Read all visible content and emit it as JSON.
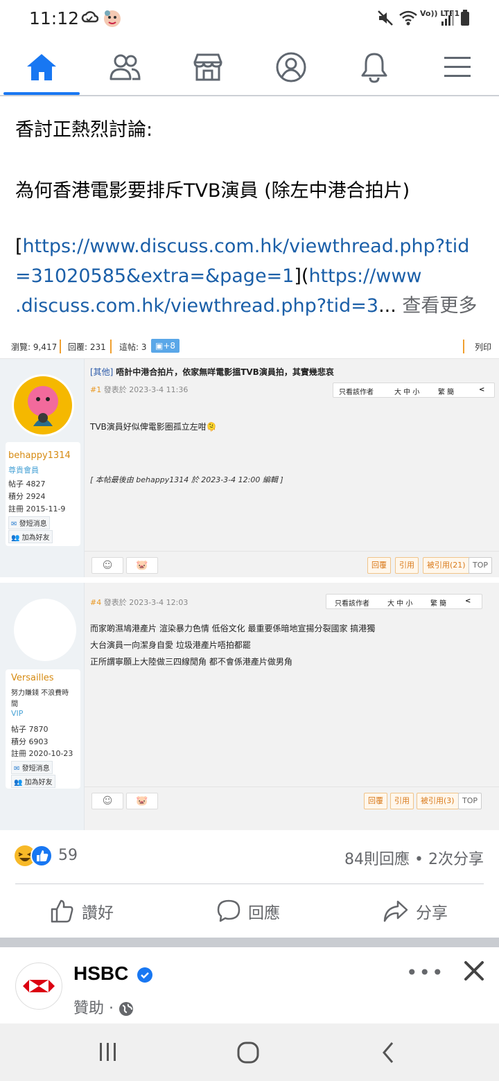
{
  "status_bar": {
    "time": "11:12",
    "network": "Vo)) LTE1"
  },
  "nav": {
    "items": [
      {
        "icon": "home-icon",
        "active": true
      },
      {
        "icon": "friends-icon",
        "active": false
      },
      {
        "icon": "marketplace-icon",
        "active": false
      },
      {
        "icon": "profile-icon",
        "active": false
      },
      {
        "icon": "bell-icon",
        "active": false
      },
      {
        "icon": "menu-icon",
        "active": false
      }
    ],
    "accent": "#1877f2"
  },
  "post": {
    "line1": "香討正熱烈討論:",
    "line2": "為何香港電影要排斥TVB演員 (除左中港合拍片)",
    "link_line1": "https://www.discuss.com.hk/viewthread.php?tid",
    "link_line2_a": "=31020585&extra=&page=1",
    "link_line2_b": "https://www",
    "link_line3": ".discuss.com.hk/viewthread.php?tid=3",
    "ellipsis": "...",
    "see_more": "查看更多"
  },
  "forum": {
    "toolbar": {
      "views": "瀏覽: 9,417",
      "replies": "回覆: 231",
      "posts": "這帖: 3",
      "badge": "+8",
      "print": "列印"
    },
    "post1": {
      "title_cat": "[其他]",
      "title": "唔計中港合拍片，依家無咩電影搵TVB演員拍，其實幾悲哀",
      "floor": "#1",
      "meta": "發表於 2023-3-4 11:36",
      "buttons": [
        "只看該作者",
        "大 中 小",
        "繁 簡",
        "<"
      ],
      "body": "TVB演員好似俾電影圈孤立左咁🫠",
      "edit_note": "[  本帖最後由  behappy1314  於  2023-3-4  12:00  編輯  ]",
      "user": {
        "name": "behappy1314",
        "rank": "尊貴會員",
        "posts": "帖子  4827",
        "points": "積分  2924",
        "reg": "註冊  2015-11-9",
        "pm": "發短消息",
        "friend": "加為好友"
      },
      "actions": [
        "回覆",
        "引用",
        "被引用(21)",
        "TOP"
      ]
    },
    "post4": {
      "floor": "#4",
      "meta": "發表於 2023-3-4 12:03",
      "buttons": [
        "只看該作者",
        "大 中 小",
        "繁 簡",
        "<"
      ],
      "body1": "而家啲濕鳩港產片  渲染暴力色情  低俗文化  最重要係暗地宣揚分裂國家  搞港獨",
      "body2": "大台演員一向潔身自愛  垃圾港產片唔拍都罷",
      "body3": "正所謂寧願上大陸做三四線閒角  都不會係港產片做男角",
      "user": {
        "name": "Versailles",
        "title1": "努力賺錢 不浪費時",
        "title2": "間",
        "rank": "VIP",
        "posts": "帖子  7870",
        "points": "積分  6903",
        "reg": "註冊  2020-10-23",
        "pm": "發短消息",
        "friend": "加為好友"
      },
      "actions": [
        "回覆",
        "引用",
        "被引用(3)",
        "TOP"
      ]
    }
  },
  "reactions": {
    "count": "59",
    "comments_shares": "84則回應 • 2次分享"
  },
  "actions": {
    "like": "讚好",
    "comment": "回應",
    "share": "分享"
  },
  "ad": {
    "name": "HSBC",
    "sponsored": "贊助 ·",
    "logo_color": "#db0011"
  }
}
